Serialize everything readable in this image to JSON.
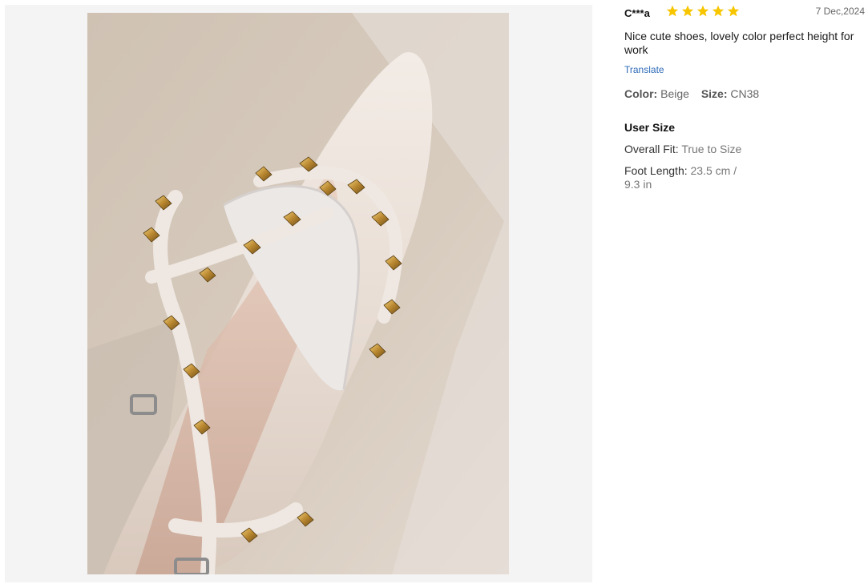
{
  "review": {
    "reviewer": "C***a",
    "rating": 5,
    "date": "7 Dec,2024",
    "text": "Nice cute shoes, lovely color perfect height for work",
    "translate_label": "Translate",
    "color_label": "Color:",
    "color_value": "Beige",
    "size_label": "Size:",
    "size_value": "CN38"
  },
  "user_size": {
    "heading": "User Size",
    "overall_fit_label": "Overall Fit:",
    "overall_fit_value": "True to Size",
    "foot_length_label": "Foot Length:",
    "foot_length_value": "23.5 cm / 9.3 in"
  },
  "colors": {
    "star": "#f7c600",
    "link": "#2e6bb8",
    "panel": "#f4f4f4"
  },
  "icons": {
    "star": "star-icon"
  }
}
